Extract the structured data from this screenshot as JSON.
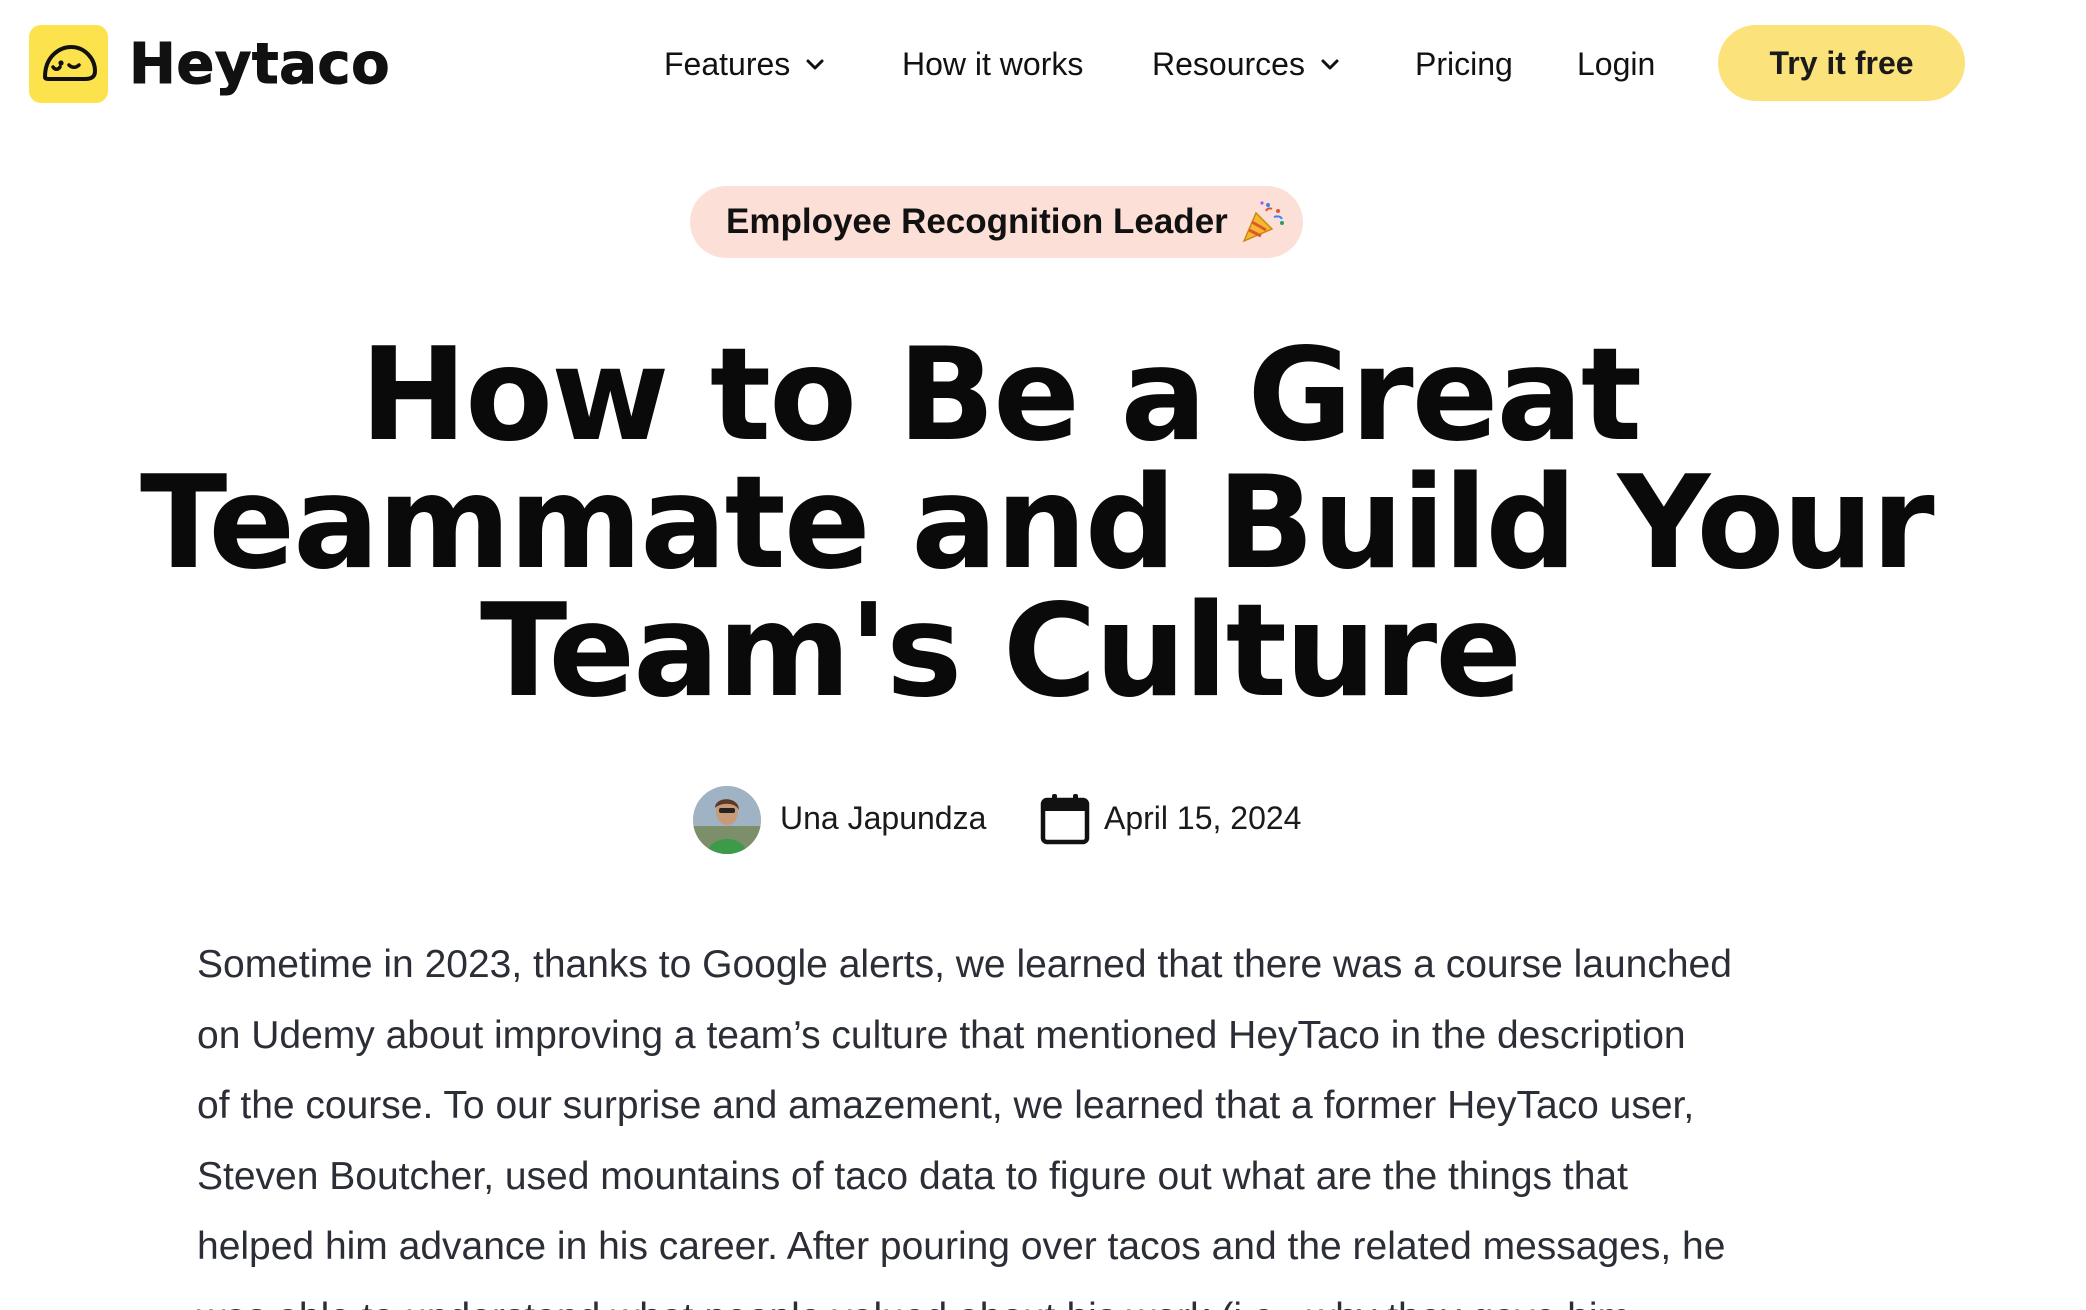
{
  "header": {
    "brand": "Heytaco",
    "nav": [
      {
        "label": "Features",
        "has_dropdown": true
      },
      {
        "label": "How it works",
        "has_dropdown": false
      },
      {
        "label": "Resources",
        "has_dropdown": true
      },
      {
        "label": "Pricing",
        "has_dropdown": false
      },
      {
        "label": "Login",
        "has_dropdown": false
      }
    ],
    "cta_label": "Try it free"
  },
  "badge": {
    "label": "Employee Recognition Leader",
    "icon": "party-popper-icon"
  },
  "article": {
    "title_lines": [
      "How to Be a Great",
      "Teammate and Build Your",
      "Team's Culture"
    ],
    "author": "Una Japundza",
    "date": "April 15, 2024",
    "body_lines": [
      "Sometime in 2023, thanks to Google alerts, we learned that there was a course launched",
      "on Udemy about improving a team’s culture that mentioned HeyTaco in the description",
      "of the course. To our surprise and amazement, we learned that a former HeyTaco user,",
      "Steven Boutcher, used mountains of taco data to figure out what are the things that",
      "helped him advance in his career. After pouring over tacos and the related messages, he",
      "was able to understand what people valued about his work (i.e., why they gave him"
    ]
  },
  "colors": {
    "brand_yellow": "#FCE34D",
    "cta_yellow": "#FCE27A",
    "badge_pink": "#FCE0D8",
    "body_text": "#2B2E36"
  }
}
